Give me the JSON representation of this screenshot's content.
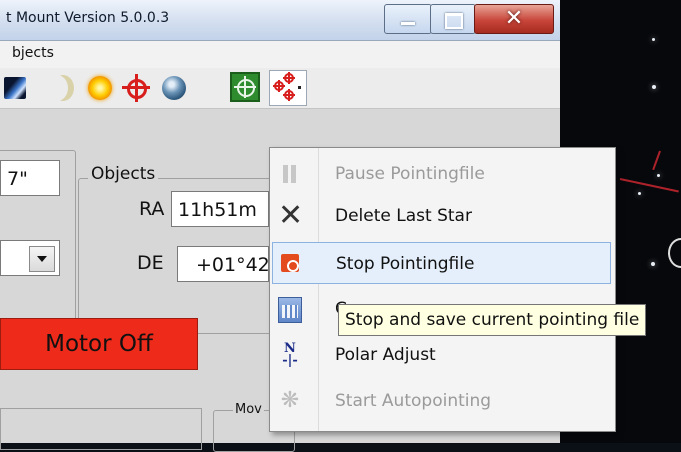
{
  "window": {
    "title": "t Mount Version 5.0.0.3"
  },
  "menu": {
    "items": [
      "bjects"
    ]
  },
  "toolbar": {
    "icons": [
      "comet-icon",
      "moon-icon",
      "sun-icon",
      "target-icon",
      "earth-icon",
      "coordinate-grid-icon",
      "pointing-stars-icon"
    ]
  },
  "main": {
    "left_value": "7\"",
    "objects_group": {
      "title": "Objects",
      "ra_label": "RA",
      "ra_value": "11h51m",
      "de_label": "DE",
      "de_value": "+01°42"
    },
    "motor_button": "Motor Off",
    "move_group_title": "Mov"
  },
  "context_menu": {
    "items": [
      {
        "label": "Pause Pointingfile",
        "icon": "pause-icon",
        "enabled": false
      },
      {
        "label": "Delete Last Star",
        "icon": "delete-x-icon",
        "enabled": true
      },
      {
        "label": "Stop Pointingfile",
        "icon": "stop-icon",
        "enabled": true,
        "highlighted": true
      },
      {
        "label": "C",
        "icon": "calculator-icon",
        "enabled": true
      },
      {
        "label": "Polar Adjust",
        "icon": "polar-adjust-icon",
        "enabled": true
      },
      {
        "label": "Start Autopointing",
        "icon": "autopointing-icon",
        "enabled": false
      }
    ]
  },
  "tooltip": {
    "text": "Stop and save current pointing file"
  },
  "colors": {
    "motor_button": "#ee2a1a",
    "menu_highlight": "#e4effb",
    "tooltip_bg": "#ffffe1"
  }
}
